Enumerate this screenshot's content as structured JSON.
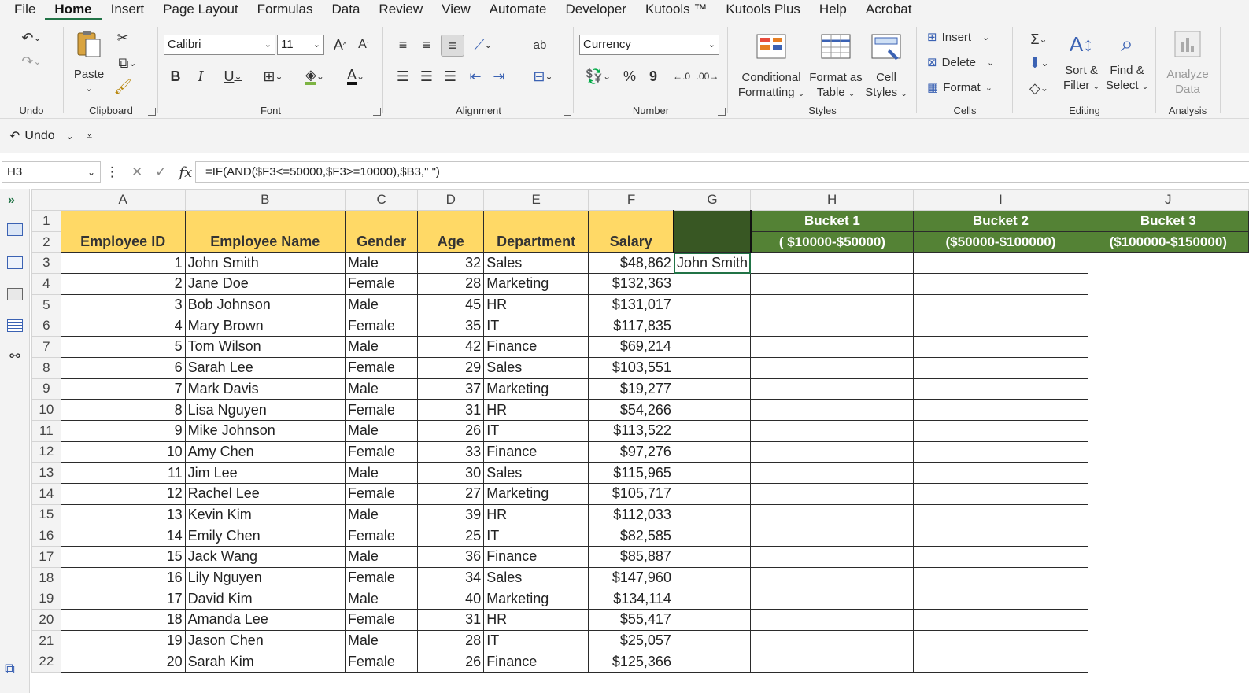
{
  "menu": {
    "items": [
      "File",
      "Home",
      "Insert",
      "Page Layout",
      "Formulas",
      "Data",
      "Review",
      "View",
      "Automate",
      "Developer",
      "Kutools ™",
      "Kutools Plus",
      "Help",
      "Acrobat"
    ],
    "active": "Home"
  },
  "ribbon": {
    "groups": {
      "undo": "Undo",
      "clipboard": "Clipboard",
      "font": "Font",
      "alignment": "Alignment",
      "number": "Number",
      "styles": "Styles",
      "cells": "Cells",
      "editing": "Editing",
      "analysis": "Analysis"
    },
    "paste_label": "Paste",
    "font_name": "Calibri",
    "font_size": "11",
    "number_format": "Currency",
    "conditional_formatting": [
      "Conditional",
      "Formatting"
    ],
    "format_as_table": [
      "Format as",
      "Table"
    ],
    "cell_styles": [
      "Cell",
      "Styles"
    ],
    "cells_insert": "Insert",
    "cells_delete": "Delete",
    "cells_format": "Format",
    "sort_filter": [
      "Sort &",
      "Filter"
    ],
    "find_select": [
      "Find &",
      "Select"
    ],
    "analyze_data": [
      "Analyze",
      "Data"
    ],
    "accent_color": "#217346"
  },
  "qab": {
    "undo_label": "Undo"
  },
  "formula_bar": {
    "name_box": "H3",
    "formula": "=IF(AND($F3<=50000,$F3>=10000),$B3,\" \")"
  },
  "sheet": {
    "columns": [
      "A",
      "B",
      "C",
      "D",
      "E",
      "F",
      "G",
      "H",
      "I",
      "J"
    ],
    "headers": {
      "employee_id": "Employee ID",
      "employee_name": "Employee Name",
      "gender": "Gender",
      "age": "Age",
      "department": "Department",
      "salary": "Salary",
      "bucket1_title": "Bucket 1",
      "bucket1_range": "( $10000-$50000)",
      "bucket2_title": "Bucket 2",
      "bucket2_range": "($50000-$100000)",
      "bucket3_title": "Bucket 3",
      "bucket3_range": "($100000-$150000)"
    },
    "colors": {
      "header_yellow": "#ffd966",
      "bucket_green": "#548235",
      "separator_green": "#385723"
    },
    "rows": [
      {
        "row": "3",
        "id": "1",
        "name": "John Smith",
        "gender": "Male",
        "age": "32",
        "dept": "Sales",
        "salary": "$48,862",
        "b1": "John Smith",
        "b2": "",
        "b3": ""
      },
      {
        "row": "4",
        "id": "2",
        "name": "Jane Doe",
        "gender": "Female",
        "age": "28",
        "dept": "Marketing",
        "salary": "$132,363",
        "b1": "",
        "b2": "",
        "b3": ""
      },
      {
        "row": "5",
        "id": "3",
        "name": "Bob Johnson",
        "gender": "Male",
        "age": "45",
        "dept": "HR",
        "salary": "$131,017",
        "b1": "",
        "b2": "",
        "b3": ""
      },
      {
        "row": "6",
        "id": "4",
        "name": "Mary Brown",
        "gender": "Female",
        "age": "35",
        "dept": "IT",
        "salary": "$117,835",
        "b1": "",
        "b2": "",
        "b3": ""
      },
      {
        "row": "7",
        "id": "5",
        "name": "Tom Wilson",
        "gender": "Male",
        "age": "42",
        "dept": "Finance",
        "salary": "$69,214",
        "b1": "",
        "b2": "",
        "b3": ""
      },
      {
        "row": "8",
        "id": "6",
        "name": "Sarah Lee",
        "gender": "Female",
        "age": "29",
        "dept": "Sales",
        "salary": "$103,551",
        "b1": "",
        "b2": "",
        "b3": ""
      },
      {
        "row": "9",
        "id": "7",
        "name": "Mark Davis",
        "gender": "Male",
        "age": "37",
        "dept": "Marketing",
        "salary": "$19,277",
        "b1": "",
        "b2": "",
        "b3": ""
      },
      {
        "row": "10",
        "id": "8",
        "name": "Lisa Nguyen",
        "gender": "Female",
        "age": "31",
        "dept": "HR",
        "salary": "$54,266",
        "b1": "",
        "b2": "",
        "b3": ""
      },
      {
        "row": "11",
        "id": "9",
        "name": "Mike Johnson",
        "gender": "Male",
        "age": "26",
        "dept": "IT",
        "salary": "$113,522",
        "b1": "",
        "b2": "",
        "b3": ""
      },
      {
        "row": "12",
        "id": "10",
        "name": "Amy Chen",
        "gender": "Female",
        "age": "33",
        "dept": "Finance",
        "salary": "$97,276",
        "b1": "",
        "b2": "",
        "b3": ""
      },
      {
        "row": "13",
        "id": "11",
        "name": "Jim Lee",
        "gender": "Male",
        "age": "30",
        "dept": "Sales",
        "salary": "$115,965",
        "b1": "",
        "b2": "",
        "b3": ""
      },
      {
        "row": "14",
        "id": "12",
        "name": "Rachel Lee",
        "gender": "Female",
        "age": "27",
        "dept": "Marketing",
        "salary": "$105,717",
        "b1": "",
        "b2": "",
        "b3": ""
      },
      {
        "row": "15",
        "id": "13",
        "name": "Kevin Kim",
        "gender": "Male",
        "age": "39",
        "dept": "HR",
        "salary": "$112,033",
        "b1": "",
        "b2": "",
        "b3": ""
      },
      {
        "row": "16",
        "id": "14",
        "name": "Emily Chen",
        "gender": "Female",
        "age": "25",
        "dept": "IT",
        "salary": "$82,585",
        "b1": "",
        "b2": "",
        "b3": ""
      },
      {
        "row": "17",
        "id": "15",
        "name": "Jack Wang",
        "gender": "Male",
        "age": "36",
        "dept": "Finance",
        "salary": "$85,887",
        "b1": "",
        "b2": "",
        "b3": ""
      },
      {
        "row": "18",
        "id": "16",
        "name": "Lily Nguyen",
        "gender": "Female",
        "age": "34",
        "dept": "Sales",
        "salary": "$147,960",
        "b1": "",
        "b2": "",
        "b3": ""
      },
      {
        "row": "19",
        "id": "17",
        "name": "David Kim",
        "gender": "Male",
        "age": "40",
        "dept": "Marketing",
        "salary": "$134,114",
        "b1": "",
        "b2": "",
        "b3": ""
      },
      {
        "row": "20",
        "id": "18",
        "name": "Amanda Lee",
        "gender": "Female",
        "age": "31",
        "dept": "HR",
        "salary": "$55,417",
        "b1": "",
        "b2": "",
        "b3": ""
      },
      {
        "row": "21",
        "id": "19",
        "name": "Jason Chen",
        "gender": "Male",
        "age": "28",
        "dept": "IT",
        "salary": "$25,057",
        "b1": "",
        "b2": "",
        "b3": ""
      },
      {
        "row": "22",
        "id": "20",
        "name": "Sarah Kim",
        "gender": "Female",
        "age": "26",
        "dept": "Finance",
        "salary": "$125,366",
        "b1": "",
        "b2": "",
        "b3": ""
      }
    ]
  }
}
